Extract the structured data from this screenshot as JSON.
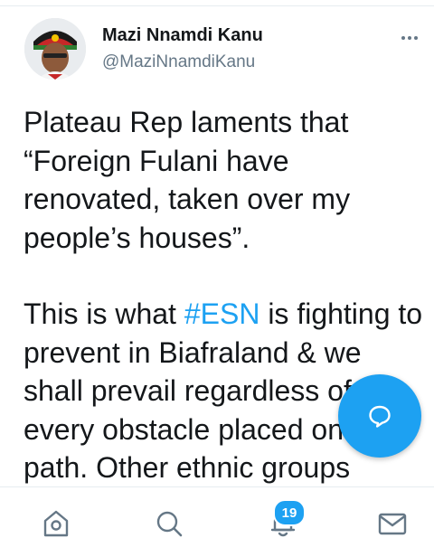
{
  "profile": {
    "name": "Mazi Nnamdi Kanu",
    "handle": "@MaziNnamdiKanu"
  },
  "tweet": {
    "paragraph1": "Plateau Rep laments that “Foreign Fulani have renovated, taken over my people’s houses”.",
    "paragraph2_before": "This is what ",
    "hashtag": "#ESN",
    "paragraph2_after": " is fighting to prevent in Biafraland & we shall prevail regardless of every obstacle placed on our path. Other ethnic groups"
  },
  "bottom_nav": {
    "items": [
      "home-icon",
      "search-icon",
      "notifications-icon",
      "messages-icon"
    ],
    "notifications_count": "19"
  },
  "compose_fab": {
    "icon": "compose-reply-icon"
  },
  "colors": {
    "accent": "#1da1f2",
    "text": "#14171a",
    "secondary_text": "#657786"
  }
}
